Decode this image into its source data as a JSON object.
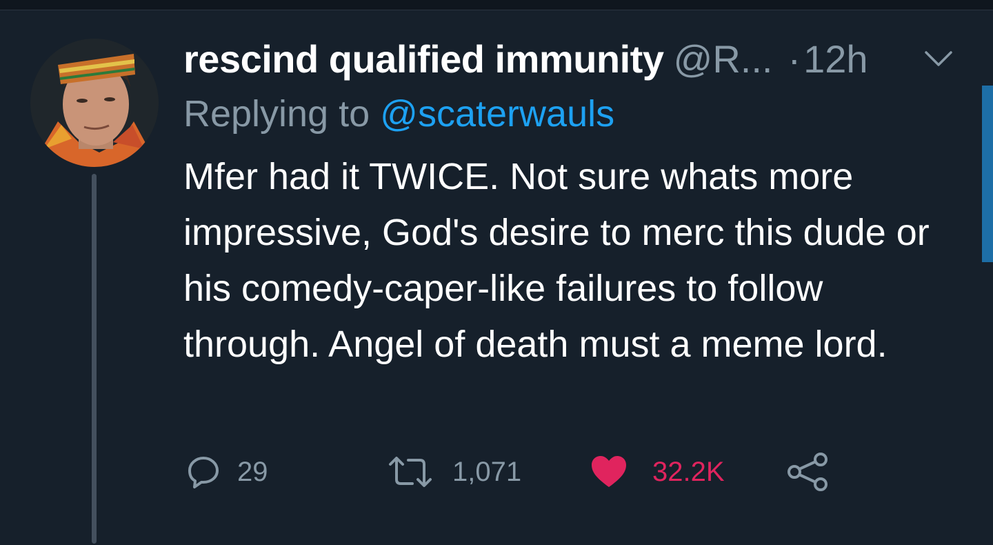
{
  "tweet": {
    "display_name": "rescind qualified immunity",
    "handle": "@R...",
    "separator": "·",
    "time": "12h",
    "replying_prefix": "Replying to ",
    "replying_to": "@scaterwauls",
    "text": "Mfer had it TWICE. Not sure whats more impressive, God's desire to merc this dude or his comedy-caper-like failures to follow through. Angel of death must a meme lord."
  },
  "actions": {
    "reply": {
      "icon": "reply-icon",
      "count": "29"
    },
    "retweet": {
      "icon": "retweet-icon",
      "count": "1,071"
    },
    "like": {
      "icon": "heart-icon",
      "count": "32.2K",
      "liked": true
    },
    "share": {
      "icon": "share-icon"
    }
  },
  "colors": {
    "background": "#16202b",
    "text_primary": "#ffffff",
    "text_secondary": "#8899a6",
    "link": "#1da1f2",
    "like": "#e0245e",
    "thread_line": "#44505e",
    "scrollbar": "#1d6ea6"
  }
}
